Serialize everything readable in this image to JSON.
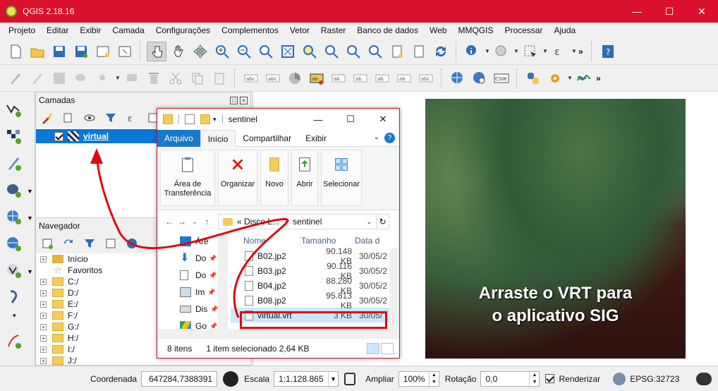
{
  "window": {
    "title": "QGIS 2.18.16",
    "minimize": "—",
    "maximize": "☐",
    "close": "✕"
  },
  "menu": [
    "Projeto",
    "Editar",
    "Exibir",
    "Camada",
    "Configurações",
    "Complementos",
    "Vetor",
    "Raster",
    "Banco de dados",
    "Web",
    "MMQGIS",
    "Processar",
    "Ajuda"
  ],
  "layers_panel": {
    "title": "Camadas",
    "layer_name": "virtual"
  },
  "navigator_panel": {
    "title": "Navegador",
    "items": [
      {
        "label": "Início",
        "type": "home",
        "expandable": true
      },
      {
        "label": "Favoritos",
        "type": "star",
        "expandable": false
      },
      {
        "label": "C:/",
        "type": "folder",
        "expandable": true
      },
      {
        "label": "D:/",
        "type": "folder",
        "expandable": true
      },
      {
        "label": "E:/",
        "type": "folder",
        "expandable": true
      },
      {
        "label": "F:/",
        "type": "folder",
        "expandable": true
      },
      {
        "label": "G:/",
        "type": "folder",
        "expandable": true
      },
      {
        "label": "H:/",
        "type": "folder",
        "expandable": true
      },
      {
        "label": "I:/",
        "type": "folder",
        "expandable": true
      },
      {
        "label": "J:/",
        "type": "folder",
        "expandable": true
      }
    ]
  },
  "explorer": {
    "title": "sentinel",
    "tabs": [
      "Arquivo",
      "Início",
      "Compartilhar",
      "Exibir"
    ],
    "ribbon": [
      {
        "label": "Área de Transferência",
        "icon": "clipboard-icon"
      },
      {
        "label": "Organizar",
        "icon": "delete-x-icon"
      },
      {
        "label": "Novo",
        "icon": "new-folder-icon"
      },
      {
        "label": "Abrir",
        "icon": "open-icon"
      },
      {
        "label": "Selecionar",
        "icon": "select-grid-icon"
      }
    ],
    "address": {
      "crumb1": "«  Disco L...",
      "crumb2": "sentinel"
    },
    "side": [
      {
        "label": "Áre",
        "icon": "desktop-icon"
      },
      {
        "label": "Do",
        "icon": "downloads-icon"
      },
      {
        "label": "Do",
        "icon": "documents-icon"
      },
      {
        "label": "Im",
        "icon": "pictures-icon"
      },
      {
        "label": "Dis",
        "icon": "drive-icon"
      },
      {
        "label": "Go",
        "icon": "google-drive-icon"
      }
    ],
    "columns": {
      "name": "Nome",
      "size": "Tamanho",
      "date": "Data d"
    },
    "files": [
      {
        "name": "B02.jp2",
        "size": "90.148 KB",
        "date": "30/05/2"
      },
      {
        "name": "B03.jp2",
        "size": "90.116 KB",
        "date": "30/05/2"
      },
      {
        "name": "B04.jp2",
        "size": "88.280 KB",
        "date": "30/05/2"
      },
      {
        "name": "B08.jp2",
        "size": "95.813 KB",
        "date": "30/05/2"
      },
      {
        "name": "virtual.vrt",
        "size": "3 KB",
        "date": "30/05/"
      }
    ],
    "status": {
      "count": "8 itens",
      "selected": "1 item selecionado  2,64 KB"
    }
  },
  "map": {
    "caption_line1": "Arraste o VRT para",
    "caption_line2": "o aplicativo SIG"
  },
  "statusbar": {
    "coord_label": "Coordenada",
    "coord_value": "647284,7388391",
    "scale_label": "Escala",
    "scale_value": "1:1.128.865",
    "magnify_label": "Ampliar",
    "magnify_value": "100%",
    "rotation_label": "Rotação",
    "rotation_value": "0,0",
    "render_label": "Renderizar",
    "crs": "EPSG:32723"
  },
  "colors": {
    "titlebar": "#d9112d",
    "selection": "#0a78d7",
    "highlight": "#e10613"
  }
}
